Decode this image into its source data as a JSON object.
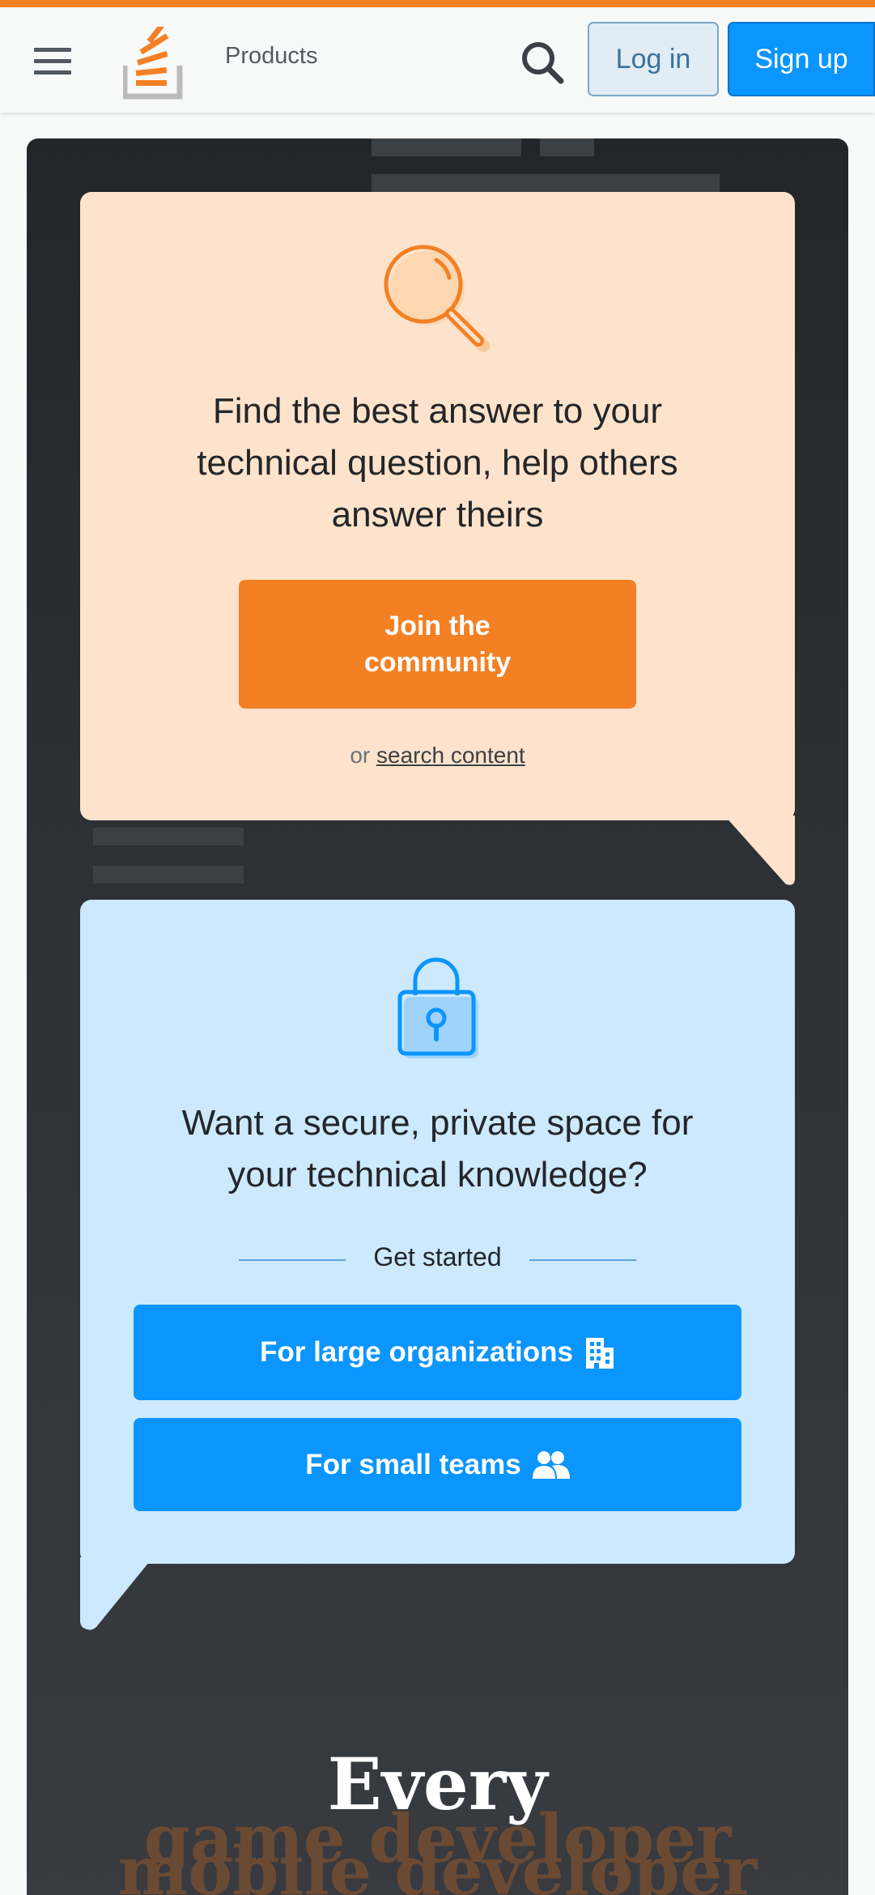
{
  "header": {
    "products_label": "Products",
    "login_label": "Log in",
    "signup_label": "Sign up"
  },
  "community_card": {
    "icon": "magnifier-icon",
    "title_lines": [
      "Find the best answer to your",
      "technical question, help others",
      "answer theirs"
    ],
    "join_lines": [
      "Join the",
      "community"
    ],
    "or_text": "or",
    "search_link": "search content"
  },
  "teams_card": {
    "icon": "padlock-icon",
    "title_lines": [
      "Want a secure, private space for",
      "your technical knowledge?"
    ],
    "get_started": "Get started",
    "large_orgs_label": "For large organizations",
    "small_teams_label": "For small teams"
  },
  "hero_footer": {
    "every": "Every",
    "roles": [
      "game developer",
      "mobile developer"
    ]
  },
  "colors": {
    "accent_orange": "#f48024",
    "primary_blue": "#0a95ff",
    "orange_card": "#fee3cc",
    "blue_card": "#cde9fe"
  }
}
